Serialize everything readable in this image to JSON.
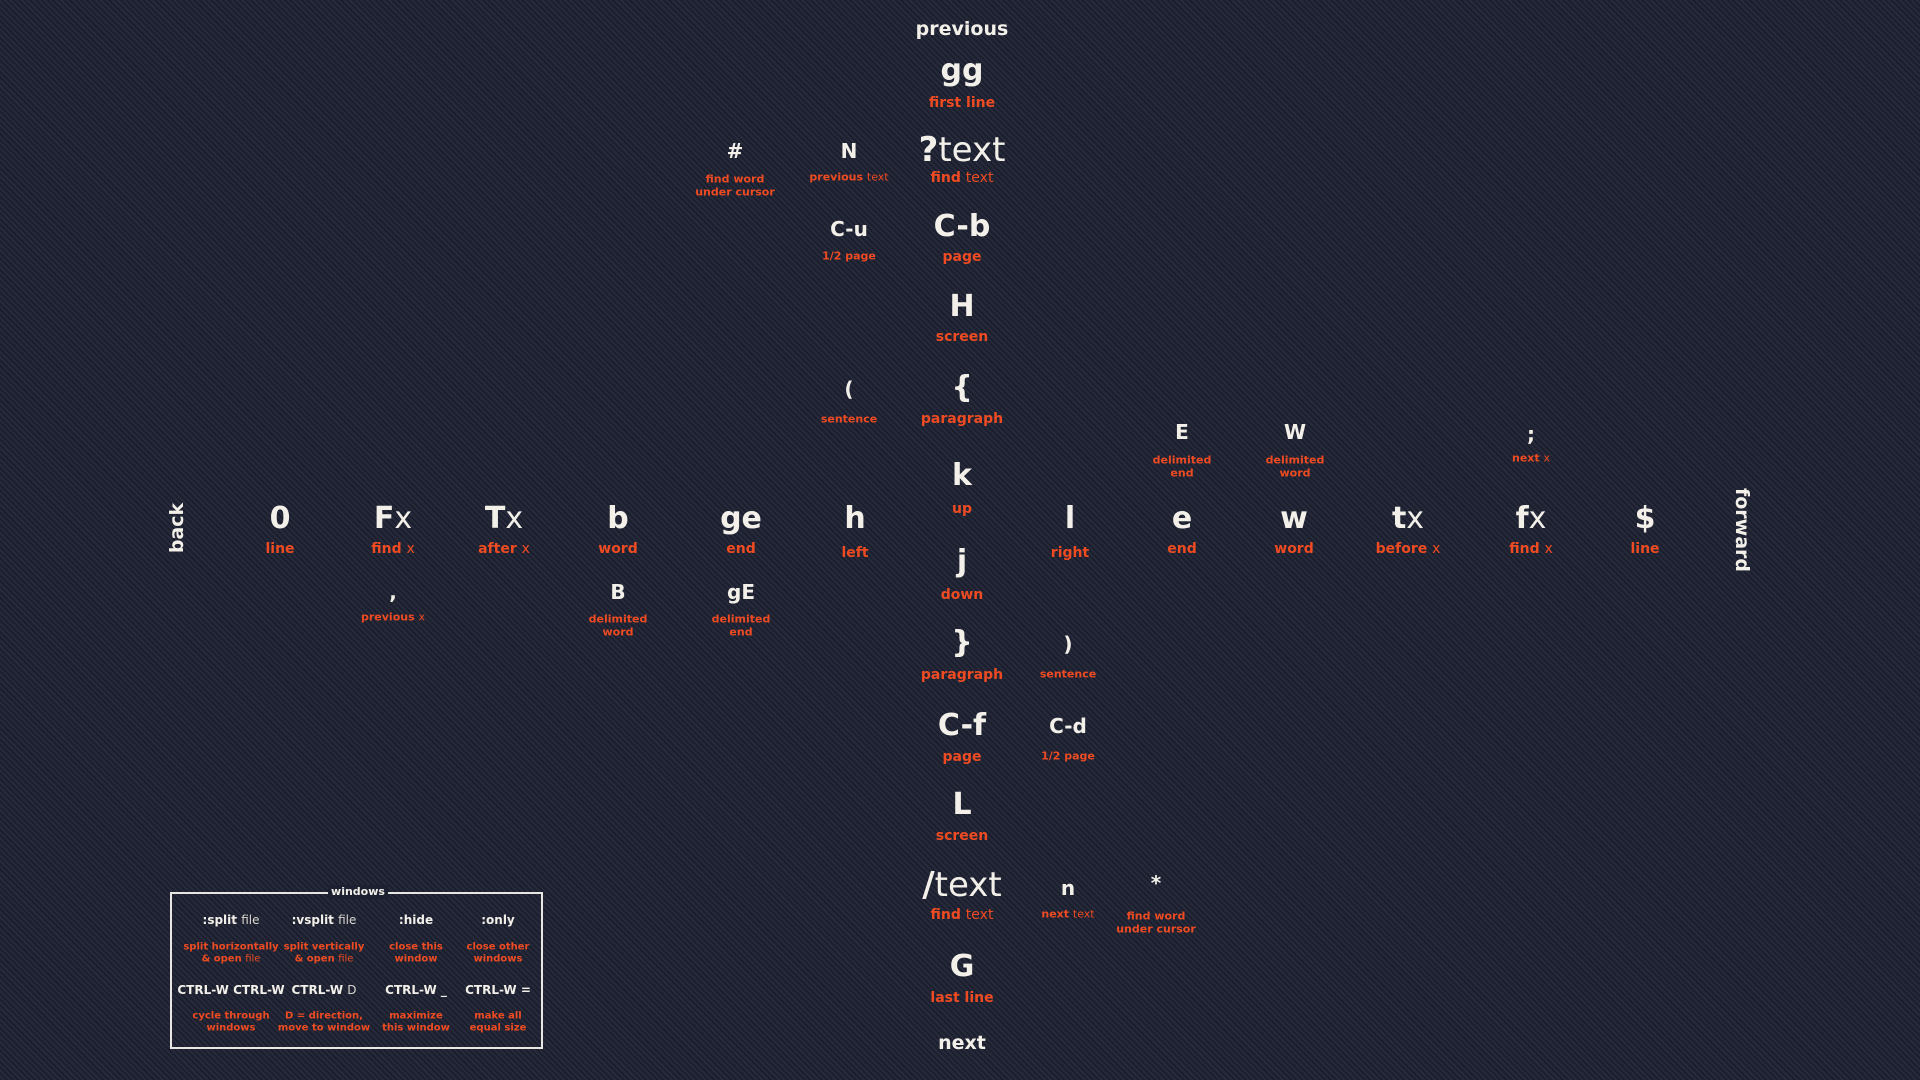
{
  "colors": {
    "background": "#1d2030",
    "key": "#f3f0ea",
    "label": "#ef4b22"
  },
  "directions": {
    "previous": "previous",
    "next": "next",
    "back": "back",
    "forward": "forward"
  },
  "vertical": {
    "gg": {
      "key": "gg",
      "label": "first line"
    },
    "search_back": {
      "key_bold": "?",
      "key_thin": "text",
      "label_bold": "find",
      "label_thin": "text"
    },
    "cb": {
      "key": "C-b",
      "label": "page"
    },
    "H": {
      "key": "H",
      "label": "screen"
    },
    "lbrace": {
      "key": "{",
      "label": "paragraph"
    },
    "k": {
      "key": "k",
      "label": "up"
    },
    "j": {
      "key": "j",
      "label": "down"
    },
    "rbrace": {
      "key": "}",
      "label": "paragraph"
    },
    "cf": {
      "key": "C-f",
      "label": "page"
    },
    "L": {
      "key": "L",
      "label": "screen"
    },
    "search_fwd": {
      "key_bold": "/",
      "key_thin": "text",
      "label_bold": "find",
      "label_thin": "text"
    },
    "G": {
      "key": "G",
      "label": "last line"
    }
  },
  "upper_side": {
    "hash": {
      "key": "#",
      "label_line1": "find word",
      "label_line2": "under cursor"
    },
    "N": {
      "key": "N",
      "label_bold": "previous",
      "label_thin": "text"
    },
    "cu": {
      "key": "C-u",
      "label": "1/2 page"
    },
    "lparen": {
      "key": "(",
      "label": "sentence"
    }
  },
  "lower_side": {
    "rparen": {
      "key": ")",
      "label": "sentence"
    },
    "cd": {
      "key": "C-d",
      "label": "1/2 page"
    },
    "n": {
      "key": "n",
      "label_bold": "next",
      "label_thin": "text"
    },
    "star": {
      "key": "*",
      "label_line1": "find word",
      "label_line2": "under cursor"
    }
  },
  "horizontal": {
    "zero": {
      "key": "0",
      "label": "line"
    },
    "Fx": {
      "key_bold": "F",
      "key_thin": "x",
      "label_bold": "find",
      "label_thin": "x"
    },
    "Tx": {
      "key_bold": "T",
      "key_thin": "x",
      "label_bold": "after",
      "label_thin": "x"
    },
    "b": {
      "key": "b",
      "label": "word"
    },
    "ge": {
      "key": "ge",
      "label": "end"
    },
    "h": {
      "key": "h",
      "label": "left"
    },
    "l": {
      "key": "l",
      "label": "right"
    },
    "e": {
      "key": "e",
      "label": "end"
    },
    "w": {
      "key": "w",
      "label": "word"
    },
    "tx": {
      "key_bold": "t",
      "key_thin": "x",
      "label_bold": "before",
      "label_thin": "x"
    },
    "fx": {
      "key_bold": "f",
      "key_thin": "x",
      "label_bold": "find",
      "label_thin": "x"
    },
    "dollar": {
      "key": "$",
      "label": "line"
    }
  },
  "horizontal_extra": {
    "comma": {
      "key": ",",
      "label_bold": "previous",
      "label_thin": "x"
    },
    "B": {
      "key": "B",
      "label_line1": "delimited",
      "label_line2": "word"
    },
    "gE": {
      "key": "gE",
      "label_line1": "delimited",
      "label_line2": "end"
    },
    "E": {
      "key": "E",
      "label_line1": "delimited",
      "label_line2": "end"
    },
    "W": {
      "key": "W",
      "label_line1": "delimited",
      "label_line2": "word"
    },
    "semicolon": {
      "key": ";",
      "label_bold": "next",
      "label_thin": "x"
    }
  },
  "windows": {
    "title": "windows",
    "commands": [
      {
        "cmd_bold": ":split",
        "cmd_thin": "file",
        "desc_line1": "split horizontally",
        "desc_line2_bold": "& open",
        "desc_line2_thin": "file"
      },
      {
        "cmd_bold": ":vsplit",
        "cmd_thin": "file",
        "desc_line1": "split vertically",
        "desc_line2_bold": "& open",
        "desc_line2_thin": "file"
      },
      {
        "cmd_bold": ":hide",
        "cmd_thin": "",
        "desc_line1": "close this",
        "desc_line2_bold": "window",
        "desc_line2_thin": ""
      },
      {
        "cmd_bold": ":only",
        "cmd_thin": "",
        "desc_line1": "close other",
        "desc_line2_bold": "windows",
        "desc_line2_thin": ""
      },
      {
        "cmd_bold": "CTRL-W CTRL-W",
        "cmd_thin": "",
        "desc_line1": "cycle through",
        "desc_line2_bold": "windows",
        "desc_line2_thin": ""
      },
      {
        "cmd_bold": "CTRL-W",
        "cmd_thin": "D",
        "desc_line1": "D = direction,",
        "desc_line2_bold": "move to window",
        "desc_line2_thin": ""
      },
      {
        "cmd_bold": "CTRL-W _",
        "cmd_thin": "",
        "desc_line1": "maximize",
        "desc_line2_bold": "this window",
        "desc_line2_thin": ""
      },
      {
        "cmd_bold": "CTRL-W =",
        "cmd_thin": "",
        "desc_line1": "make all",
        "desc_line2_bold": "equal size",
        "desc_line2_thin": ""
      }
    ]
  }
}
